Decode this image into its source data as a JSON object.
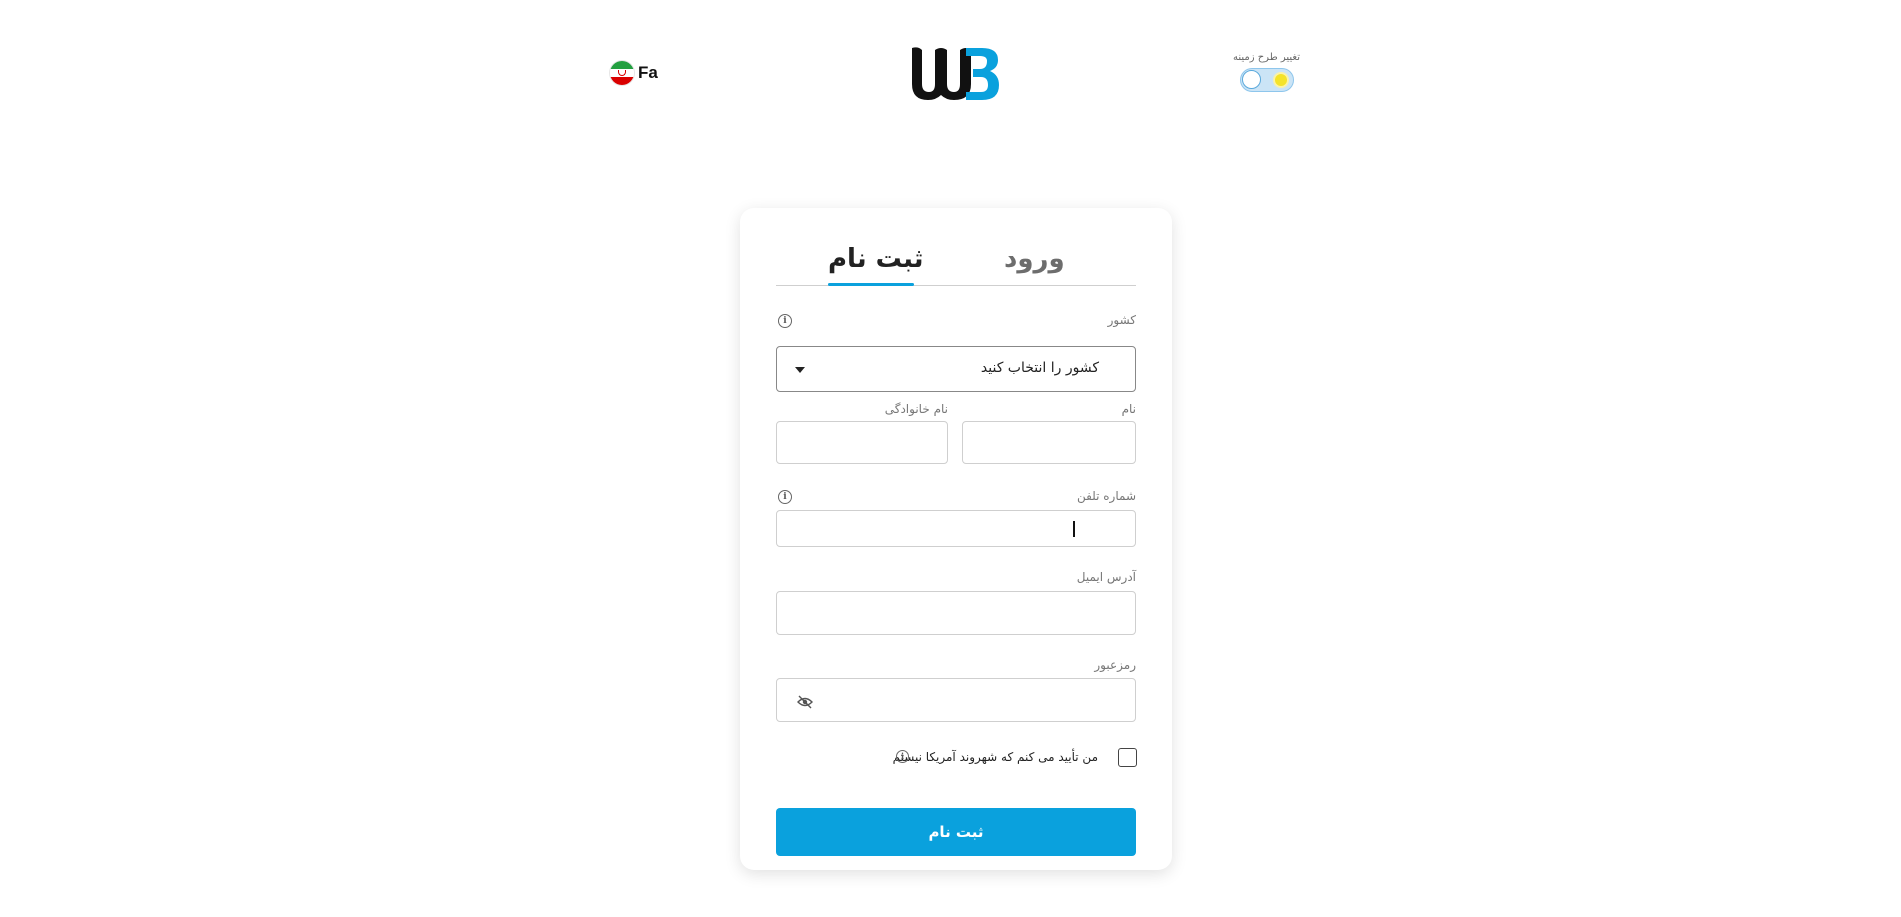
{
  "header": {
    "language": {
      "label": "Fa",
      "flag_icon": "iran-flag-icon"
    },
    "logo_icon": "wb-logo",
    "theme": {
      "label": "تغییر طرح زمینه",
      "mode": "light",
      "sun_icon": "sun-icon"
    }
  },
  "tabs": [
    {
      "label": "ورود",
      "active": false
    },
    {
      "label": "ثبت نام",
      "active": true
    }
  ],
  "form": {
    "country": {
      "label": "کشور",
      "value": "کشور را انتخاب کنید",
      "info_icon": "info-icon"
    },
    "first_name": {
      "label": "نام",
      "value": ""
    },
    "last_name": {
      "label": "نام خانوادگی",
      "value": ""
    },
    "phone": {
      "label": "شماره تلفن",
      "value": "",
      "info_icon": "info-icon"
    },
    "email": {
      "label": "آدرس ایمیل",
      "value": ""
    },
    "password": {
      "label": "رمزعبور",
      "value": "",
      "toggle_icon": "eye-slash-icon"
    },
    "us_citizen": {
      "label": "من تأیید می کنم که شهروند آمریکا نیستم",
      "checked": false,
      "info_icon": "info-icon"
    },
    "submit_label": "ثبت نام"
  },
  "colors": {
    "accent": "#0aa1dd",
    "logo_dark": "#111111",
    "logo_blue": "#0aa1dd"
  }
}
